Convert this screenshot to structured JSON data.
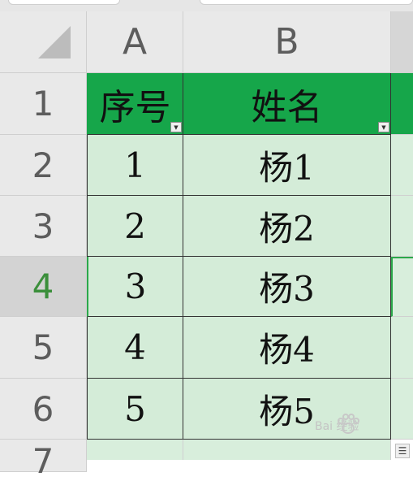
{
  "columns": [
    {
      "label": "A"
    },
    {
      "label": "B"
    }
  ],
  "rows": [
    {
      "num": "1",
      "a": "序号",
      "b": "姓名",
      "header": true
    },
    {
      "num": "2",
      "a": "1",
      "b": "杨1"
    },
    {
      "num": "3",
      "a": "2",
      "b": "杨2"
    },
    {
      "num": "4",
      "a": "3",
      "b": "杨3",
      "active": true
    },
    {
      "num": "5",
      "a": "4",
      "b": "杨4"
    },
    {
      "num": "6",
      "a": "5",
      "b": "杨5"
    },
    {
      "num": "7"
    }
  ],
  "filter_dropdown_icon": "triangle-down",
  "watermark": "Bai 经验",
  "colors": {
    "header_fill": "#16a64a",
    "body_fill": "#d4ecd8",
    "active_row_number": "#3b8f3b",
    "grid_header_bg": "#e9e9e9"
  }
}
